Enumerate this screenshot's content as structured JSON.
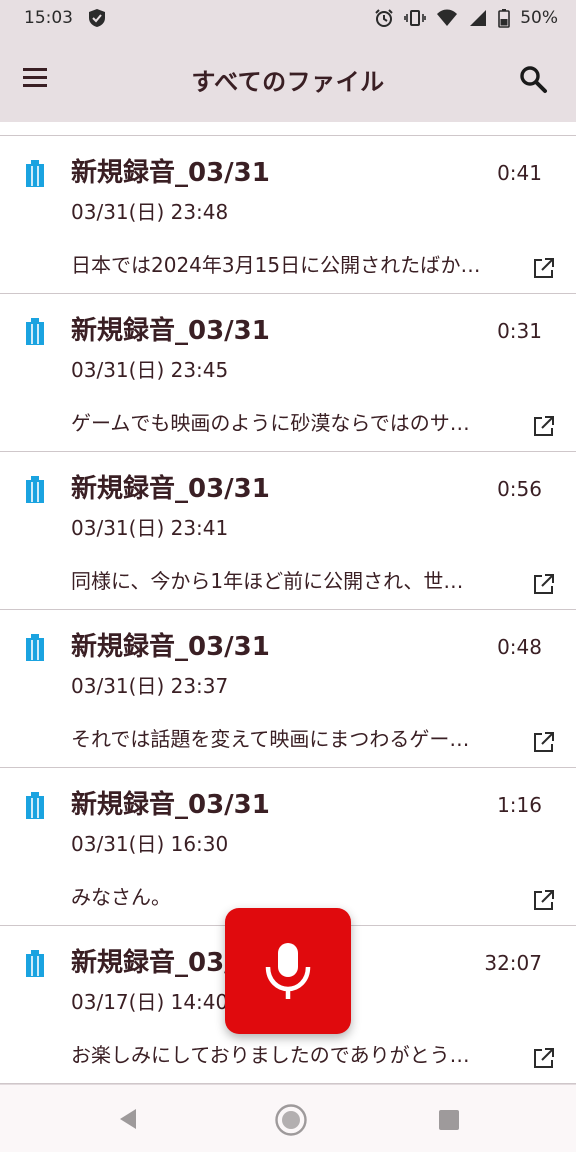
{
  "status_bar": {
    "time": "15:03",
    "battery": "50%"
  },
  "header": {
    "title": "すべてのファイル",
    "menu_icon": "hamburger-menu-icon",
    "search_icon": "search-icon"
  },
  "colors": {
    "header_bg": "#e7dfe2",
    "text": "#3a1f24",
    "accent_blue": "#1aa3e0",
    "fab_red": "#e00a0d"
  },
  "recordings": [
    {
      "title": "新規録音_03/31",
      "date": "03/31(日) 23:48",
      "duration": "0:41",
      "snippet": "日本では2024年3月15日に公開されたばか…"
    },
    {
      "title": "新規録音_03/31",
      "date": "03/31(日) 23:45",
      "duration": "0:31",
      "snippet": "ゲームでも映画のように砂漠ならではのサ…"
    },
    {
      "title": "新規録音_03/31",
      "date": "03/31(日) 23:41",
      "duration": "0:56",
      "snippet": "同様に、今から1年ほど前に公開され、世…"
    },
    {
      "title": "新規録音_03/31",
      "date": "03/31(日) 23:37",
      "duration": "0:48",
      "snippet": "それでは話題を変えて映画にまつわるゲー…"
    },
    {
      "title": "新規録音_03/31",
      "date": "03/31(日) 16:30",
      "duration": "1:16",
      "snippet": "みなさん。"
    },
    {
      "title": "新規録音_03/31",
      "date": "03/17(日) 14:40",
      "duration": "32:07",
      "snippet": "お楽しみにしておりましたのでありがとう…"
    }
  ],
  "fab": {
    "icon": "microphone-icon"
  },
  "nav": {
    "back_icon": "back-triangle-icon",
    "home_icon": "home-circle-icon",
    "recent_icon": "recent-square-icon"
  }
}
